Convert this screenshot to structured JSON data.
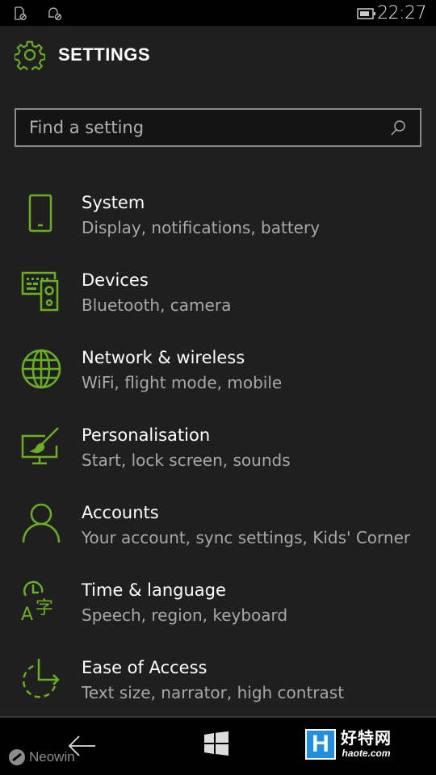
{
  "statusbar": {
    "icons": [
      "sim-blocked-icon",
      "notification-blocked-icon",
      "battery-icon"
    ],
    "time": "22:27"
  },
  "header": {
    "title": "SETTINGS",
    "icon": "gear-icon"
  },
  "search": {
    "placeholder": "Find a setting",
    "value": "",
    "icon": "search-icon"
  },
  "accent_color": "#6aaf21",
  "items": [
    {
      "name": "System",
      "desc": "Display, notifications, battery",
      "icon": "phone-icon"
    },
    {
      "name": "Devices",
      "desc": "Bluetooth, camera",
      "icon": "devices-icon"
    },
    {
      "name": "Network & wireless",
      "desc": "WiFi, flight mode, mobile",
      "icon": "globe-icon"
    },
    {
      "name": "Personalisation",
      "desc": "Start, lock screen, sounds",
      "icon": "paintbrush-monitor-icon"
    },
    {
      "name": "Accounts",
      "desc": "Your account, sync settings, Kids' Corner",
      "icon": "person-icon"
    },
    {
      "name": "Time & language",
      "desc": "Speech, region, keyboard",
      "icon": "time-language-icon"
    },
    {
      "name": "Ease of Access",
      "desc": "Text size, narrator, high contrast",
      "icon": "ease-of-access-icon"
    }
  ],
  "navbar": {
    "back": "back-arrow-icon",
    "start": "windows-logo-icon"
  },
  "watermarks": {
    "neowin": "Neowin",
    "haote_letter": "H",
    "haote_cn": "好特网",
    "haote_en": "haote.com"
  }
}
